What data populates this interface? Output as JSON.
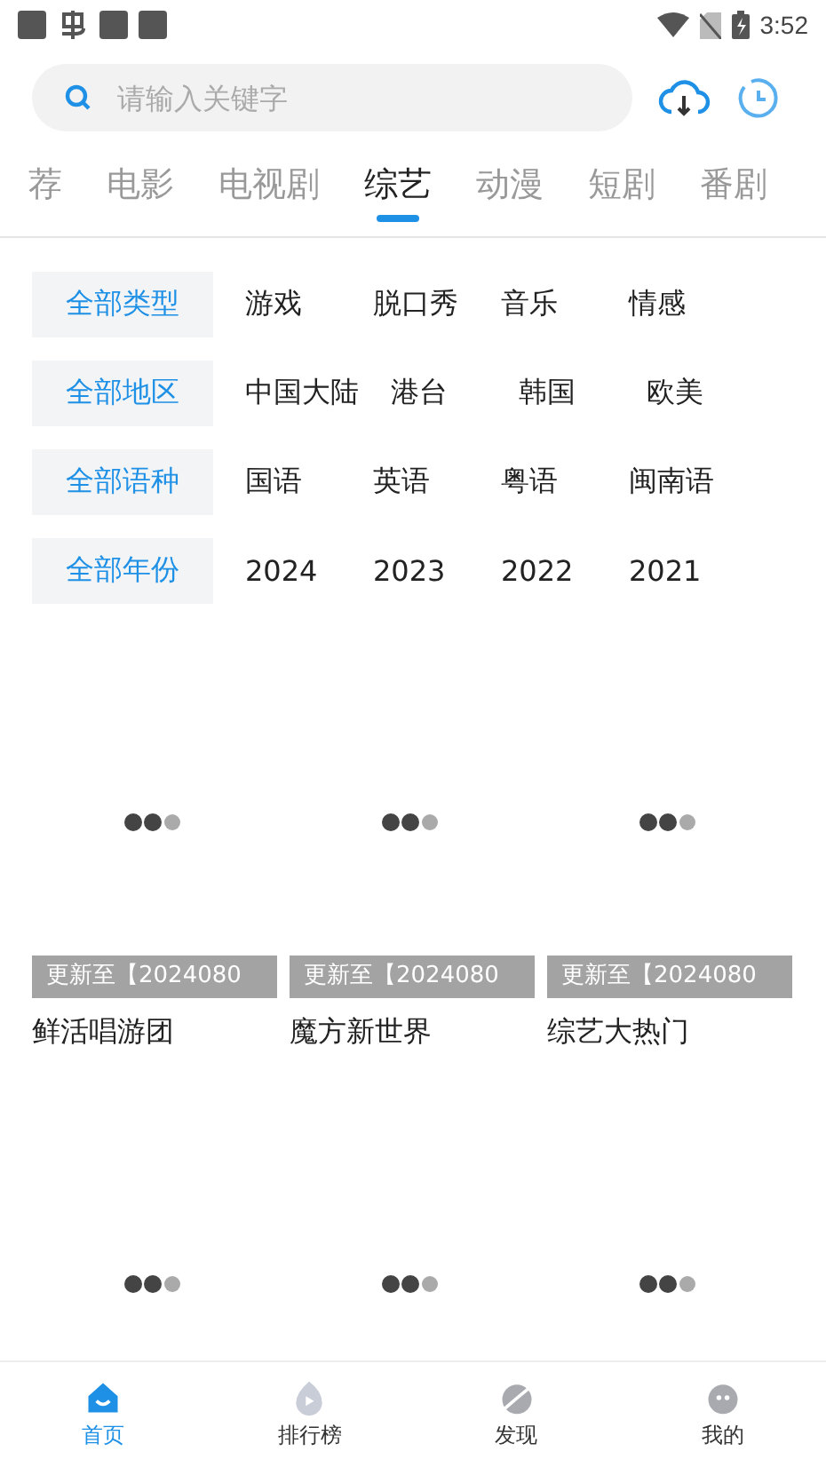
{
  "status_bar": {
    "time": "3:52"
  },
  "search": {
    "placeholder": "请输入关键字"
  },
  "tabs": [
    {
      "label": "荐",
      "selected": false
    },
    {
      "label": "电影",
      "selected": false
    },
    {
      "label": "电视剧",
      "selected": false
    },
    {
      "label": "综艺",
      "selected": true
    },
    {
      "label": "动漫",
      "selected": false
    },
    {
      "label": "短剧",
      "selected": false
    },
    {
      "label": "番剧",
      "selected": false
    }
  ],
  "filters": [
    {
      "options": [
        {
          "label": "全部类型",
          "selected": true
        },
        {
          "label": "游戏",
          "selected": false
        },
        {
          "label": "脱口秀",
          "selected": false
        },
        {
          "label": "音乐",
          "selected": false
        },
        {
          "label": "情感",
          "selected": false
        }
      ]
    },
    {
      "options": [
        {
          "label": "全部地区",
          "selected": true
        },
        {
          "label": "中国大陆",
          "selected": false
        },
        {
          "label": "港台",
          "selected": false
        },
        {
          "label": "韩国",
          "selected": false
        },
        {
          "label": "欧美",
          "selected": false
        }
      ]
    },
    {
      "options": [
        {
          "label": "全部语种",
          "selected": true
        },
        {
          "label": "国语",
          "selected": false
        },
        {
          "label": "英语",
          "selected": false
        },
        {
          "label": "粤语",
          "selected": false
        },
        {
          "label": "闽南语",
          "selected": false
        }
      ]
    },
    {
      "options": [
        {
          "label": "全部年份",
          "selected": true
        },
        {
          "label": "2024",
          "selected": false
        },
        {
          "label": "2023",
          "selected": false
        },
        {
          "label": "2022",
          "selected": false
        },
        {
          "label": "2021",
          "selected": false
        }
      ]
    }
  ],
  "shows": [
    {
      "kind": "titled",
      "update": "更新至【2024080",
      "title": "鲜活唱游团"
    },
    {
      "kind": "titled",
      "update": "更新至【2024080",
      "title": "魔方新世界"
    },
    {
      "kind": "titled",
      "update": "更新至【2024080",
      "title": "综艺大热门"
    },
    {
      "kind": "loading"
    },
    {
      "kind": "loading"
    },
    {
      "kind": "loading"
    }
  ],
  "bottom_nav": [
    {
      "label": "首页",
      "kind": "home",
      "selected": true
    },
    {
      "label": "排行榜",
      "kind": "rank",
      "selected": false
    },
    {
      "label": "发现",
      "kind": "discover",
      "selected": false
    },
    {
      "label": "我的",
      "kind": "me",
      "selected": false
    }
  ]
}
